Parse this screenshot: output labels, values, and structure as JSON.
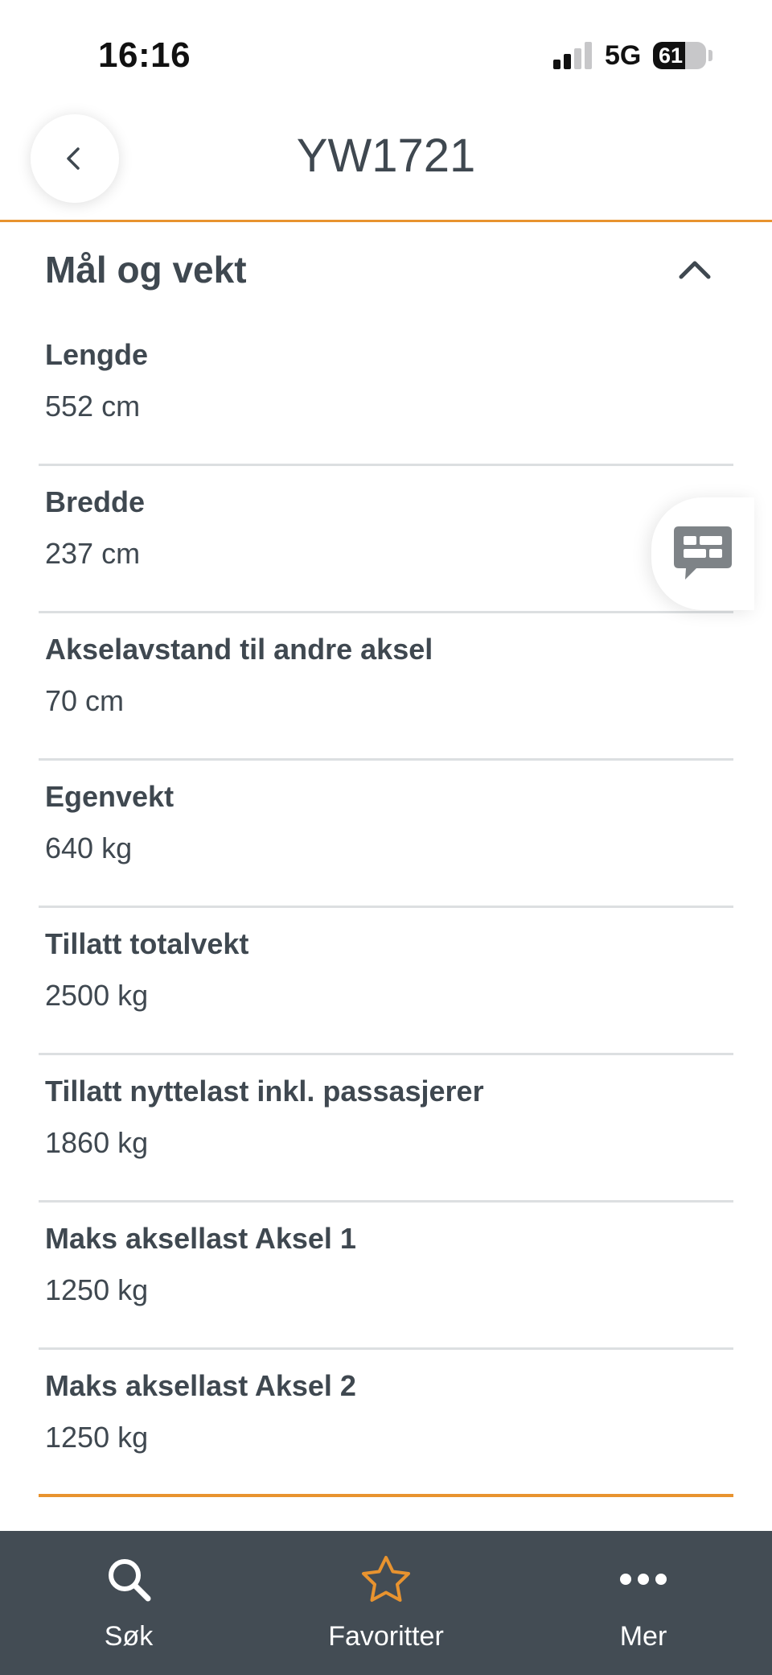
{
  "status_bar": {
    "time": "16:16",
    "network": "5G",
    "battery": "61",
    "battery_level": 0.61
  },
  "header": {
    "title": "YW1721",
    "back_icon": "chevron-left-icon"
  },
  "section": {
    "title": "Mål og vekt",
    "toggle_icon": "chevron-up-icon",
    "rows": [
      {
        "label": "Lengde",
        "value": "552 cm"
      },
      {
        "label": "Bredde",
        "value": "237 cm"
      },
      {
        "label": "Akselavstand til andre aksel",
        "value": "70 cm"
      },
      {
        "label": "Egenvekt",
        "value": "640 kg"
      },
      {
        "label": "Tillatt totalvekt",
        "value": "2500 kg"
      },
      {
        "label": "Tillatt nyttelast inkl. passasjerer",
        "value": "1860 kg"
      },
      {
        "label": "Maks aksellast Aksel 1",
        "value": "1250 kg"
      },
      {
        "label": "Maks aksellast Aksel 2",
        "value": "1250 kg"
      }
    ]
  },
  "feedback": {
    "icon": "feedback-chat-icon"
  },
  "bottom_nav": {
    "items": [
      {
        "label": "Søk",
        "icon": "search-icon"
      },
      {
        "label": "Favoritter",
        "icon": "star-icon"
      },
      {
        "label": "Mer",
        "icon": "more-dots-icon"
      }
    ]
  },
  "colors": {
    "accent": "#e8932f",
    "text": "#3f4850",
    "nav_background": "#434c54",
    "divider": "#dcdfe1"
  }
}
